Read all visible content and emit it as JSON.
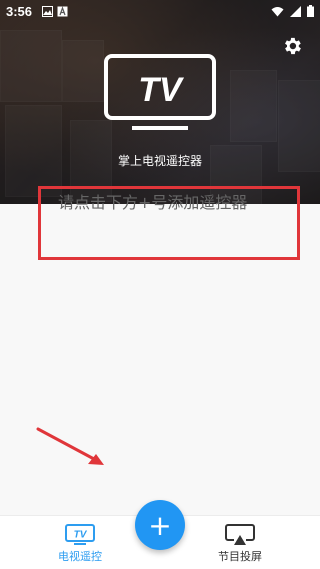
{
  "status_bar": {
    "time": "3:56",
    "left_icons": [
      "image-icon",
      "a-icon"
    ],
    "right_icons": [
      "wifi-icon",
      "signal-icon",
      "battery-icon"
    ]
  },
  "hero": {
    "logo_text": "TV",
    "title": "掌上电视遥控器",
    "settings_icon": "gear-icon"
  },
  "prompt": {
    "text": "请点击下方+号添加遥控器"
  },
  "fab": {
    "label": "+"
  },
  "bottom_nav": {
    "items": [
      {
        "label": "电视遥控",
        "icon": "tv-icon",
        "active": true
      },
      {
        "label": "节目投屏",
        "icon": "cast-icon",
        "active": false
      }
    ]
  },
  "colors": {
    "accent": "#2196f3",
    "highlight_box": "#e0363a",
    "active_tab": "#2d9df0"
  }
}
